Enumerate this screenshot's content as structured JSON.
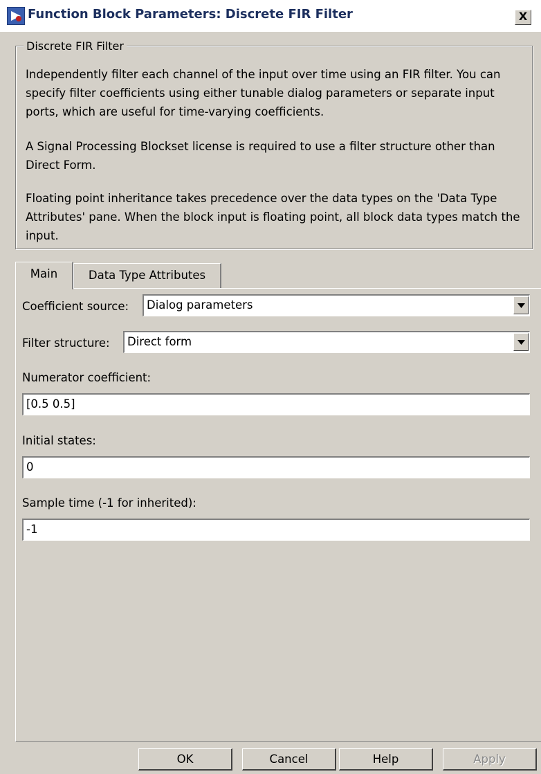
{
  "window": {
    "title": "Function Block Parameters: Discrete FIR Filter",
    "close_label": "X"
  },
  "group": {
    "legend": "Discrete FIR Filter",
    "paragraphs": [
      "Independently filter each channel of the input over time using an FIR filter. You can specify filter coefficients using either tunable dialog parameters or separate input ports, which are useful for time-varying coefficients.",
      "A Signal Processing Blockset license is required to use a filter structure other than Direct Form.",
      "Floating point inheritance takes precedence over the data types on the 'Data Type Attributes' pane. When the block input is floating point, all block data types match the input."
    ]
  },
  "tabs": [
    {
      "label": "Main",
      "active": true
    },
    {
      "label": "Data Type Attributes",
      "active": false
    }
  ],
  "main": {
    "coefficient_source": {
      "label": "Coefficient source:",
      "value": "Dialog parameters"
    },
    "filter_structure": {
      "label": "Filter structure:",
      "value": "Direct form"
    },
    "numerator": {
      "label": "Numerator coefficient:",
      "value": "[0.5 0.5]"
    },
    "initial_states": {
      "label": "Initial states:",
      "value": "0"
    },
    "sample_time": {
      "label": "Sample time (-1 for inherited):",
      "value": "-1"
    }
  },
  "buttons": {
    "ok": "OK",
    "cancel": "Cancel",
    "help": "Help",
    "apply": "Apply"
  },
  "colors": {
    "dialog_bg": "#d4d0c8",
    "title_text": "#1c2f5e",
    "disabled_text": "#8a8a8a"
  }
}
